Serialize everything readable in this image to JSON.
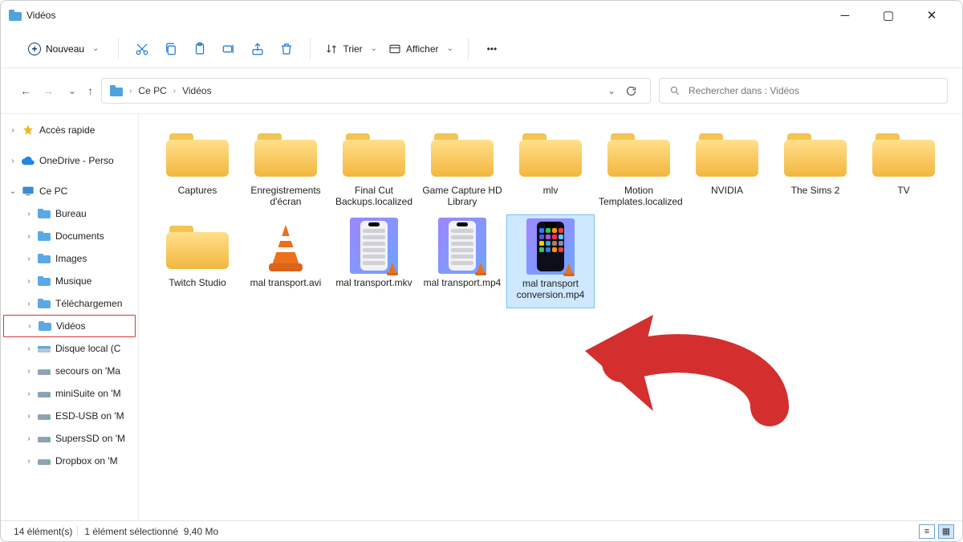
{
  "window_title": "Vidéos",
  "toolbar": {
    "new_label": "Nouveau",
    "sort_label": "Trier",
    "view_label": "Afficher"
  },
  "breadcrumb": {
    "segments": [
      "Ce PC",
      "Vidéos"
    ]
  },
  "search": {
    "placeholder": "Rechercher dans : Vidéos"
  },
  "sidebar": {
    "quick_access": "Accès rapide",
    "onedrive": "OneDrive - Perso",
    "this_pc": "Ce PC",
    "desktop": "Bureau",
    "documents": "Documents",
    "images": "Images",
    "music": "Musique",
    "downloads": "Téléchargemen",
    "videos": "Vidéos",
    "local_disk": "Disque local (C",
    "net1": "secours on 'Ma",
    "net2": "miniSuite on 'M",
    "net3": "ESD-USB on 'M",
    "net4": "SupersSD on 'M",
    "net5": "Dropbox on 'M"
  },
  "items": {
    "folders": [
      "Captures",
      "Enregistrements d'écran",
      "Final Cut Backups.localized",
      "Game Capture HD Library",
      "mlv",
      "Motion Templates.localized",
      "NVIDIA",
      "The Sims 2",
      "TV",
      "Twitch Studio"
    ],
    "files": [
      "mal transport.avi",
      "mal transport.mkv",
      "mal transport.mp4",
      "mal transport conversion.mp4"
    ]
  },
  "status": {
    "count_label": "14 élément(s)",
    "selected_label": "1 élément sélectionné",
    "selected_size": "9,40 Mo"
  },
  "icons": {
    "star": "star-icon",
    "cloud": "cloud-icon",
    "monitor": "monitor-icon",
    "folder_sm": "folder-icon",
    "drive": "drive-icon"
  }
}
